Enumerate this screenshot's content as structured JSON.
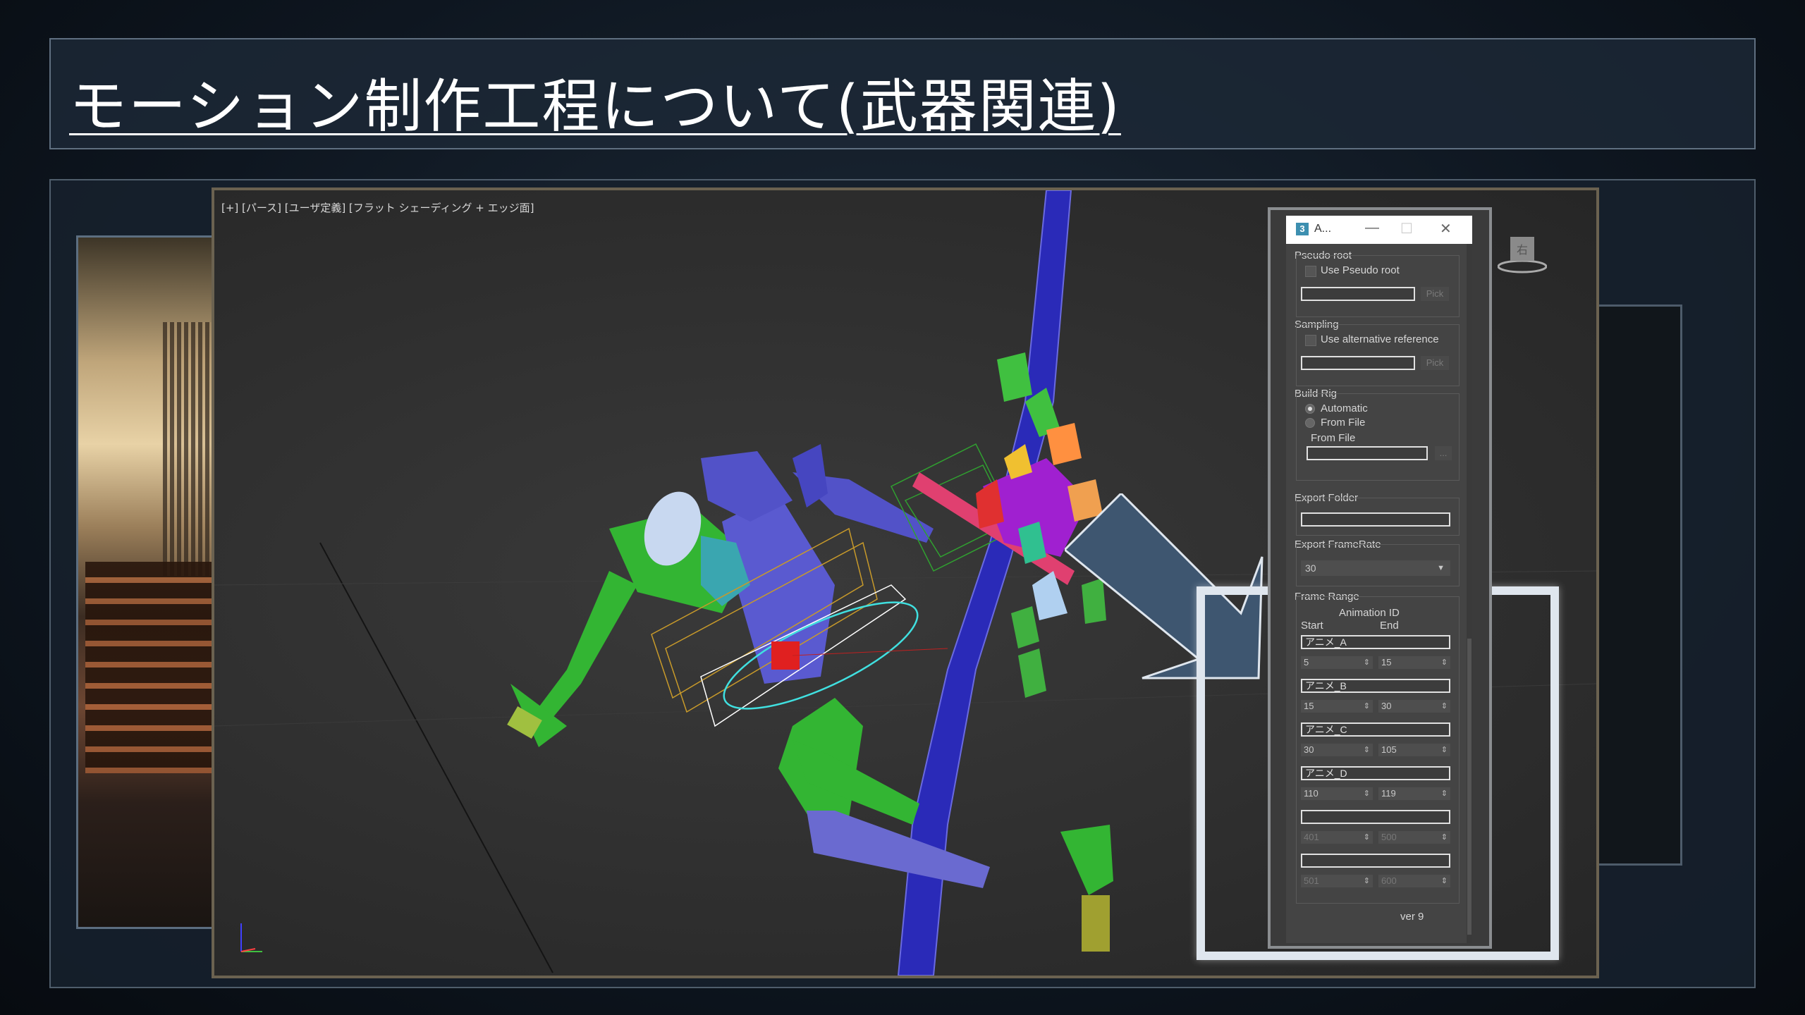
{
  "slide": {
    "title": "モーション制作工程について(武器関連)"
  },
  "viewport": {
    "label": "[+] [パース] [ユーザ定義] [フラット シェーディング + エッジ面]",
    "viewcube_label": "右"
  },
  "dialog": {
    "title": "A...",
    "pseudo_root": {
      "group_label": "Pseudo root",
      "checkbox_label": "Use Pseudo root",
      "field_value": "",
      "pick_label": "Pick"
    },
    "sampling": {
      "group_label": "Sampling",
      "checkbox_label": "Use alternative reference",
      "field_value": "",
      "pick_label": "Pick"
    },
    "build_rig": {
      "group_label": "Build Rig",
      "option_automatic": "Automatic",
      "option_from_file": "From File",
      "from_file_label": "From File",
      "browse_label": "..."
    },
    "export_folder": {
      "group_label": "Export Folder",
      "value": ""
    },
    "export_framerate": {
      "group_label": "Export FrameRate",
      "value": "30"
    },
    "frame_range": {
      "group_label": "Frame Range",
      "animation_id_label": "Animation ID",
      "start_label": "Start",
      "end_label": "End",
      "rows": [
        {
          "id": "アニメ_A",
          "start": "5",
          "end": "15"
        },
        {
          "id": "アニメ_B",
          "start": "15",
          "end": "30"
        },
        {
          "id": "アニメ_C",
          "start": "30",
          "end": "105"
        },
        {
          "id": "アニメ_D",
          "start": "110",
          "end": "119"
        },
        {
          "id": "",
          "start": "401",
          "end": "500"
        },
        {
          "id": "",
          "start": "501",
          "end": "600"
        }
      ]
    },
    "version": "ver 9"
  },
  "colors": {
    "accent_arrow": "#3e5670",
    "highlight_border": "#dfe6ee",
    "bone_green": "#33b533",
    "bone_blue": "#5252c8",
    "weapon_blue": "#2a2ab8"
  }
}
